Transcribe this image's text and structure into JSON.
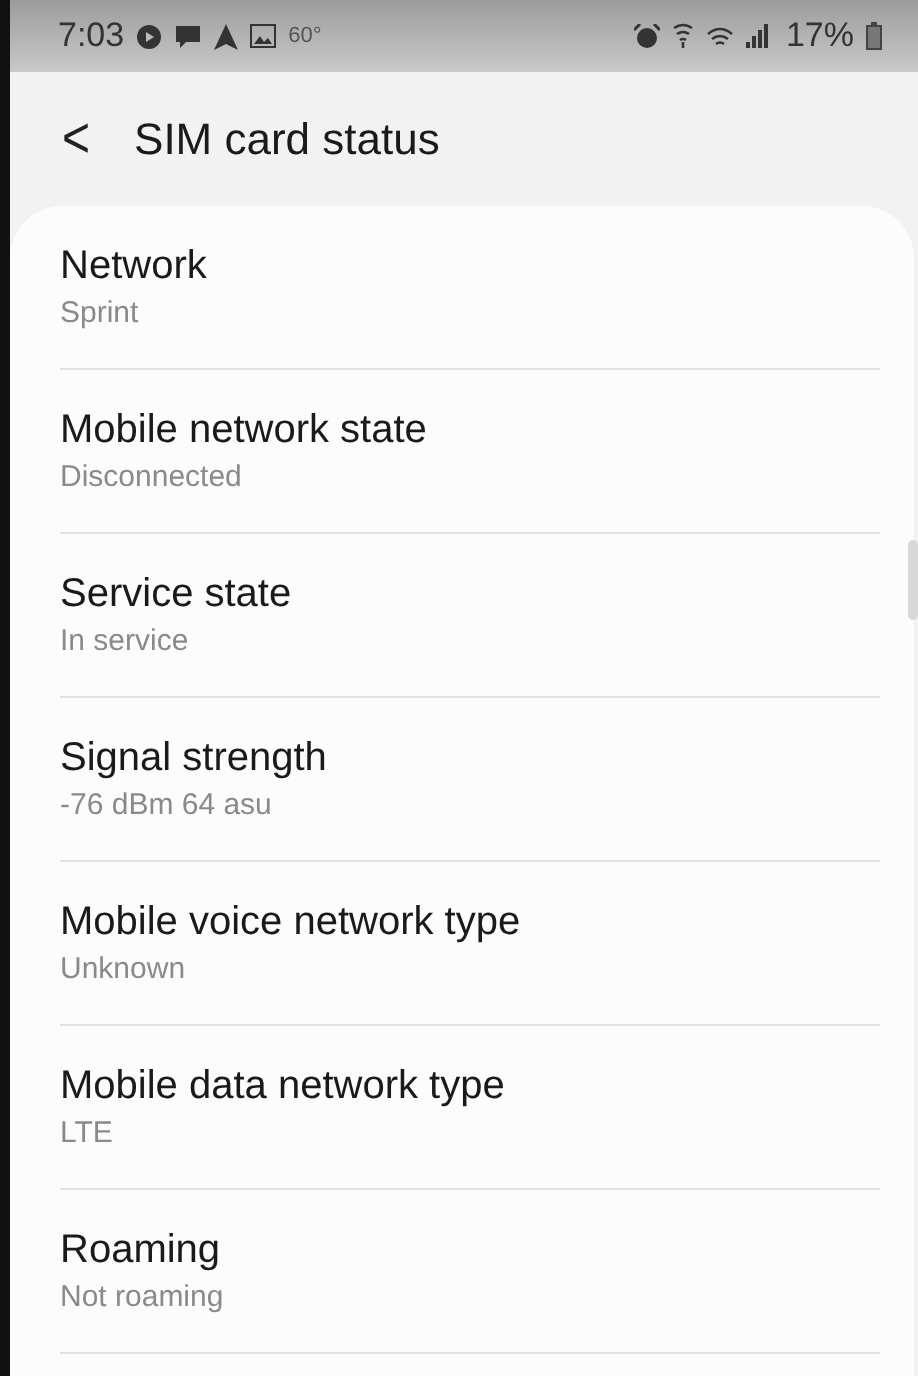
{
  "status_bar": {
    "time": "7:03",
    "temperature": "60°",
    "battery": "17%"
  },
  "header": {
    "back": "<",
    "title": "SIM card status"
  },
  "items": [
    {
      "title": "Network",
      "value": "Sprint"
    },
    {
      "title": "Mobile network state",
      "value": "Disconnected"
    },
    {
      "title": "Service state",
      "value": "In service"
    },
    {
      "title": "Signal strength",
      "value": "-76 dBm 64 asu"
    },
    {
      "title": "Mobile voice network type",
      "value": "Unknown"
    },
    {
      "title": "Mobile data network type",
      "value": "LTE"
    },
    {
      "title": "Roaming",
      "value": "Not roaming"
    }
  ]
}
